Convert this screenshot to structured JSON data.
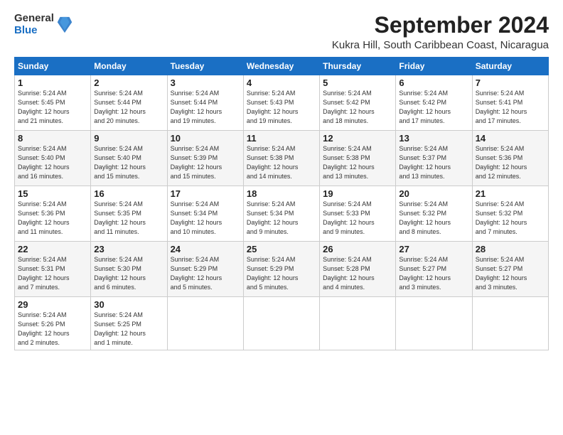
{
  "header": {
    "logo_general": "General",
    "logo_blue": "Blue",
    "month_title": "September 2024",
    "location": "Kukra Hill, South Caribbean Coast, Nicaragua"
  },
  "columns": [
    "Sunday",
    "Monday",
    "Tuesday",
    "Wednesday",
    "Thursday",
    "Friday",
    "Saturday"
  ],
  "weeks": [
    [
      {
        "day": "1",
        "info": "Sunrise: 5:24 AM\nSunset: 5:45 PM\nDaylight: 12 hours\nand 21 minutes."
      },
      {
        "day": "2",
        "info": "Sunrise: 5:24 AM\nSunset: 5:44 PM\nDaylight: 12 hours\nand 20 minutes."
      },
      {
        "day": "3",
        "info": "Sunrise: 5:24 AM\nSunset: 5:44 PM\nDaylight: 12 hours\nand 19 minutes."
      },
      {
        "day": "4",
        "info": "Sunrise: 5:24 AM\nSunset: 5:43 PM\nDaylight: 12 hours\nand 19 minutes."
      },
      {
        "day": "5",
        "info": "Sunrise: 5:24 AM\nSunset: 5:42 PM\nDaylight: 12 hours\nand 18 minutes."
      },
      {
        "day": "6",
        "info": "Sunrise: 5:24 AM\nSunset: 5:42 PM\nDaylight: 12 hours\nand 17 minutes."
      },
      {
        "day": "7",
        "info": "Sunrise: 5:24 AM\nSunset: 5:41 PM\nDaylight: 12 hours\nand 17 minutes."
      }
    ],
    [
      {
        "day": "8",
        "info": "Sunrise: 5:24 AM\nSunset: 5:40 PM\nDaylight: 12 hours\nand 16 minutes."
      },
      {
        "day": "9",
        "info": "Sunrise: 5:24 AM\nSunset: 5:40 PM\nDaylight: 12 hours\nand 15 minutes."
      },
      {
        "day": "10",
        "info": "Sunrise: 5:24 AM\nSunset: 5:39 PM\nDaylight: 12 hours\nand 15 minutes."
      },
      {
        "day": "11",
        "info": "Sunrise: 5:24 AM\nSunset: 5:38 PM\nDaylight: 12 hours\nand 14 minutes."
      },
      {
        "day": "12",
        "info": "Sunrise: 5:24 AM\nSunset: 5:38 PM\nDaylight: 12 hours\nand 13 minutes."
      },
      {
        "day": "13",
        "info": "Sunrise: 5:24 AM\nSunset: 5:37 PM\nDaylight: 12 hours\nand 13 minutes."
      },
      {
        "day": "14",
        "info": "Sunrise: 5:24 AM\nSunset: 5:36 PM\nDaylight: 12 hours\nand 12 minutes."
      }
    ],
    [
      {
        "day": "15",
        "info": "Sunrise: 5:24 AM\nSunset: 5:36 PM\nDaylight: 12 hours\nand 11 minutes."
      },
      {
        "day": "16",
        "info": "Sunrise: 5:24 AM\nSunset: 5:35 PM\nDaylight: 12 hours\nand 11 minutes."
      },
      {
        "day": "17",
        "info": "Sunrise: 5:24 AM\nSunset: 5:34 PM\nDaylight: 12 hours\nand 10 minutes."
      },
      {
        "day": "18",
        "info": "Sunrise: 5:24 AM\nSunset: 5:34 PM\nDaylight: 12 hours\nand 9 minutes."
      },
      {
        "day": "19",
        "info": "Sunrise: 5:24 AM\nSunset: 5:33 PM\nDaylight: 12 hours\nand 9 minutes."
      },
      {
        "day": "20",
        "info": "Sunrise: 5:24 AM\nSunset: 5:32 PM\nDaylight: 12 hours\nand 8 minutes."
      },
      {
        "day": "21",
        "info": "Sunrise: 5:24 AM\nSunset: 5:32 PM\nDaylight: 12 hours\nand 7 minutes."
      }
    ],
    [
      {
        "day": "22",
        "info": "Sunrise: 5:24 AM\nSunset: 5:31 PM\nDaylight: 12 hours\nand 7 minutes."
      },
      {
        "day": "23",
        "info": "Sunrise: 5:24 AM\nSunset: 5:30 PM\nDaylight: 12 hours\nand 6 minutes."
      },
      {
        "day": "24",
        "info": "Sunrise: 5:24 AM\nSunset: 5:29 PM\nDaylight: 12 hours\nand 5 minutes."
      },
      {
        "day": "25",
        "info": "Sunrise: 5:24 AM\nSunset: 5:29 PM\nDaylight: 12 hours\nand 5 minutes."
      },
      {
        "day": "26",
        "info": "Sunrise: 5:24 AM\nSunset: 5:28 PM\nDaylight: 12 hours\nand 4 minutes."
      },
      {
        "day": "27",
        "info": "Sunrise: 5:24 AM\nSunset: 5:27 PM\nDaylight: 12 hours\nand 3 minutes."
      },
      {
        "day": "28",
        "info": "Sunrise: 5:24 AM\nSunset: 5:27 PM\nDaylight: 12 hours\nand 3 minutes."
      }
    ],
    [
      {
        "day": "29",
        "info": "Sunrise: 5:24 AM\nSunset: 5:26 PM\nDaylight: 12 hours\nand 2 minutes."
      },
      {
        "day": "30",
        "info": "Sunrise: 5:24 AM\nSunset: 5:25 PM\nDaylight: 12 hours\nand 1 minute."
      },
      null,
      null,
      null,
      null,
      null
    ]
  ]
}
